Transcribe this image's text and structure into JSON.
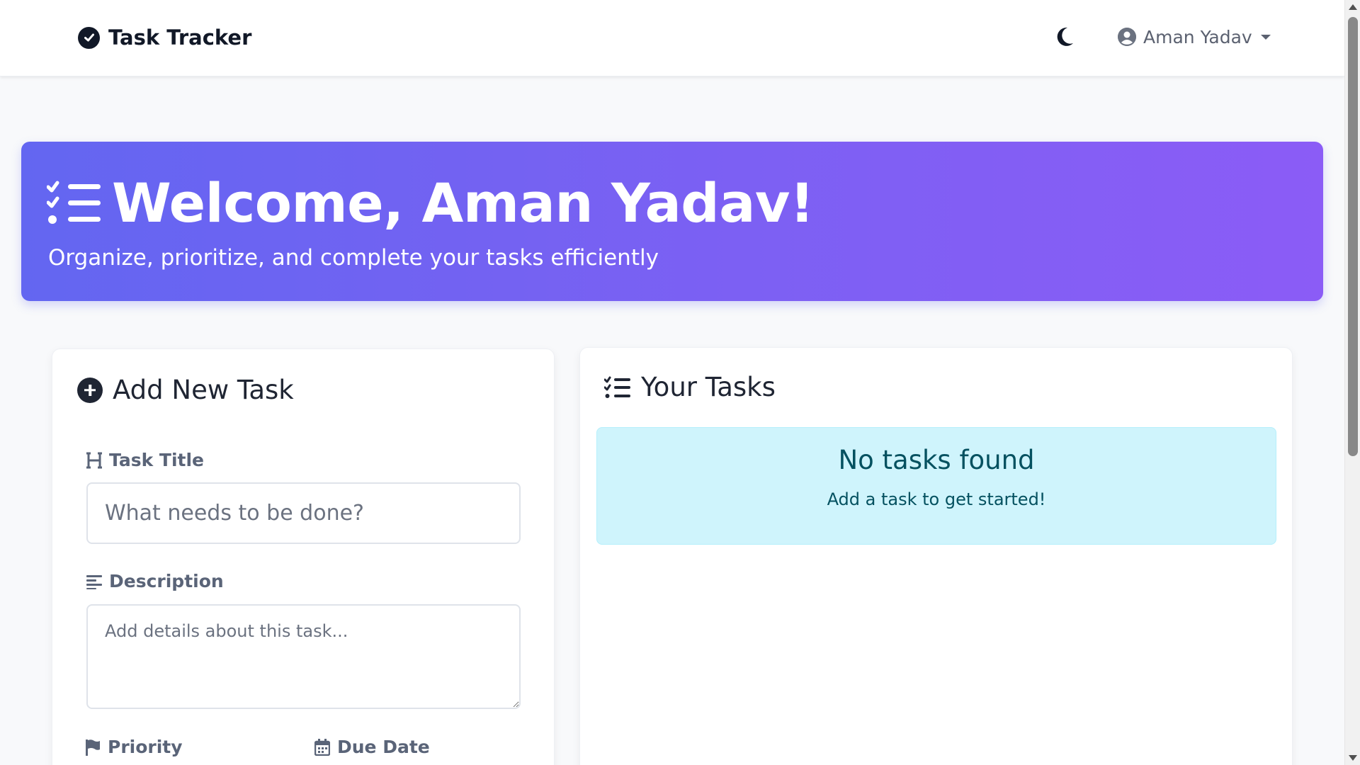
{
  "navbar": {
    "brand": "Task Tracker",
    "user_name": "Aman Yadav"
  },
  "hero": {
    "title": "Welcome, Aman Yadav!",
    "subtitle": "Organize, prioritize, and complete your tasks efficiently"
  },
  "add_task": {
    "heading": "Add New Task",
    "title_label": "Task Title",
    "title_placeholder": "What needs to be done?",
    "description_label": "Description",
    "description_placeholder": "Add details about this task...",
    "priority_label": "Priority",
    "due_date_label": "Due Date"
  },
  "tasks": {
    "heading": "Your Tasks",
    "empty_title": "No tasks found",
    "empty_subtitle": "Add a task to get started!"
  },
  "colors": {
    "hero_gradient_start": "#6366f1",
    "hero_gradient_end": "#8b5cf6",
    "alert_bg": "#cff4fc",
    "alert_text": "#055160"
  }
}
